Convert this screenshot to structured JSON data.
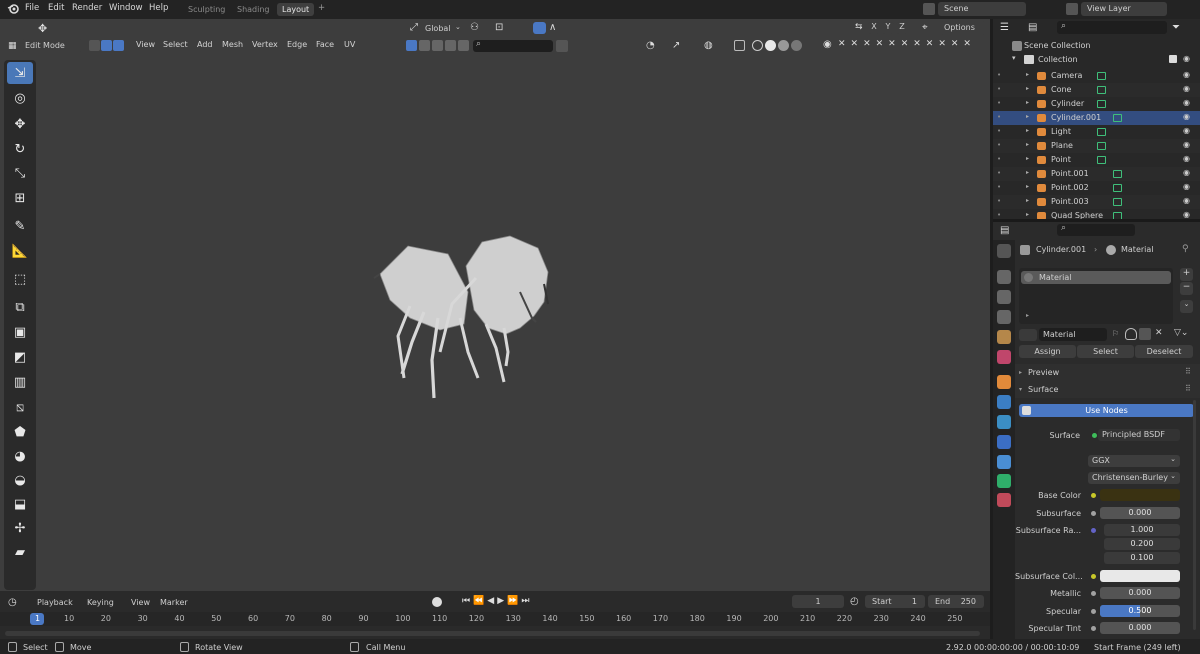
{
  "menubar": {
    "items": [
      "File",
      "Edit",
      "Render",
      "Window",
      "Help"
    ],
    "workspaces": [
      "Sculpting",
      "Shading",
      "Layout"
    ],
    "active_workspace": "Layout",
    "add_tab": "+",
    "scene": "Scene",
    "view_layer": "View Layer"
  },
  "viewport_header": {
    "mode": "Edit Mode",
    "menus": [
      "View",
      "Select",
      "Add",
      "Mesh",
      "Vertex",
      "Edge",
      "Face",
      "UV"
    ],
    "orientation": "Global",
    "options": "Options",
    "axes": [
      "X",
      "Y",
      "Z"
    ]
  },
  "timeline": {
    "menus": [
      "Playback",
      "Keying",
      "View",
      "Marker"
    ],
    "current_frame": "1",
    "start_label": "Start",
    "start_value": "1",
    "end_label": "End",
    "end_value": "250",
    "ticks": [
      "1",
      "10",
      "20",
      "30",
      "40",
      "50",
      "60",
      "70",
      "80",
      "90",
      "100",
      "110",
      "120",
      "130",
      "140",
      "150",
      "160",
      "170",
      "180",
      "190",
      "200",
      "210",
      "220",
      "230",
      "240",
      "250"
    ]
  },
  "statusbar": {
    "select": "Select",
    "move": "Move",
    "rotate": "Rotate View",
    "call_menu": "Call Menu",
    "version": "2.92.0",
    "time": "00:00:00:00 / 00:00:10:09",
    "start_frame": "Start Frame (249 left)"
  },
  "outliner": {
    "scene_collection": "Scene Collection",
    "collection": "Collection",
    "objects": [
      {
        "name": "Camera",
        "icon": "camera-icon"
      },
      {
        "name": "Cone",
        "icon": "mesh-icon"
      },
      {
        "name": "Cylinder",
        "icon": "mesh-icon"
      },
      {
        "name": "Cylinder.001",
        "icon": "mesh-icon"
      },
      {
        "name": "Light",
        "icon": "light-icon"
      },
      {
        "name": "Plane",
        "icon": "mesh-icon"
      },
      {
        "name": "Point",
        "icon": "light-icon"
      },
      {
        "name": "Point.001",
        "icon": "light-icon"
      },
      {
        "name": "Point.002",
        "icon": "light-icon"
      },
      {
        "name": "Point.003",
        "icon": "light-icon"
      },
      {
        "name": "Quad Sphere",
        "icon": "mesh-icon"
      }
    ]
  },
  "properties": {
    "object": "Cylinder.001",
    "material_tab": "Material",
    "slot": "Material",
    "material_name": "Material",
    "assign": "Assign",
    "select": "Select",
    "deselect": "Deselect",
    "preview": "Preview",
    "surface_panel": "Surface",
    "use_nodes": "Use Nodes",
    "surface_label": "Surface",
    "surface_value": "Principled BSDF",
    "distribution": "GGX",
    "subsurface_method": "Christensen-Burley",
    "rows": [
      {
        "label": "Base Color",
        "value": ""
      },
      {
        "label": "Subsurface",
        "value": "0.000"
      },
      {
        "label": "Subsurface Ra...",
        "value": "1.000"
      },
      {
        "label": "",
        "value": "0.200"
      },
      {
        "label": "",
        "value": "0.100"
      },
      {
        "label": "Subsurface Col...",
        "value": ""
      },
      {
        "label": "Metallic",
        "value": "0.000"
      },
      {
        "label": "Specular",
        "value": "0.500"
      },
      {
        "label": "Specular Tint",
        "value": "0.000"
      }
    ],
    "colors": {
      "base_color": "#3a3212",
      "subsurface_color": "#e8e8e8",
      "accent": "#4a78c4"
    }
  }
}
